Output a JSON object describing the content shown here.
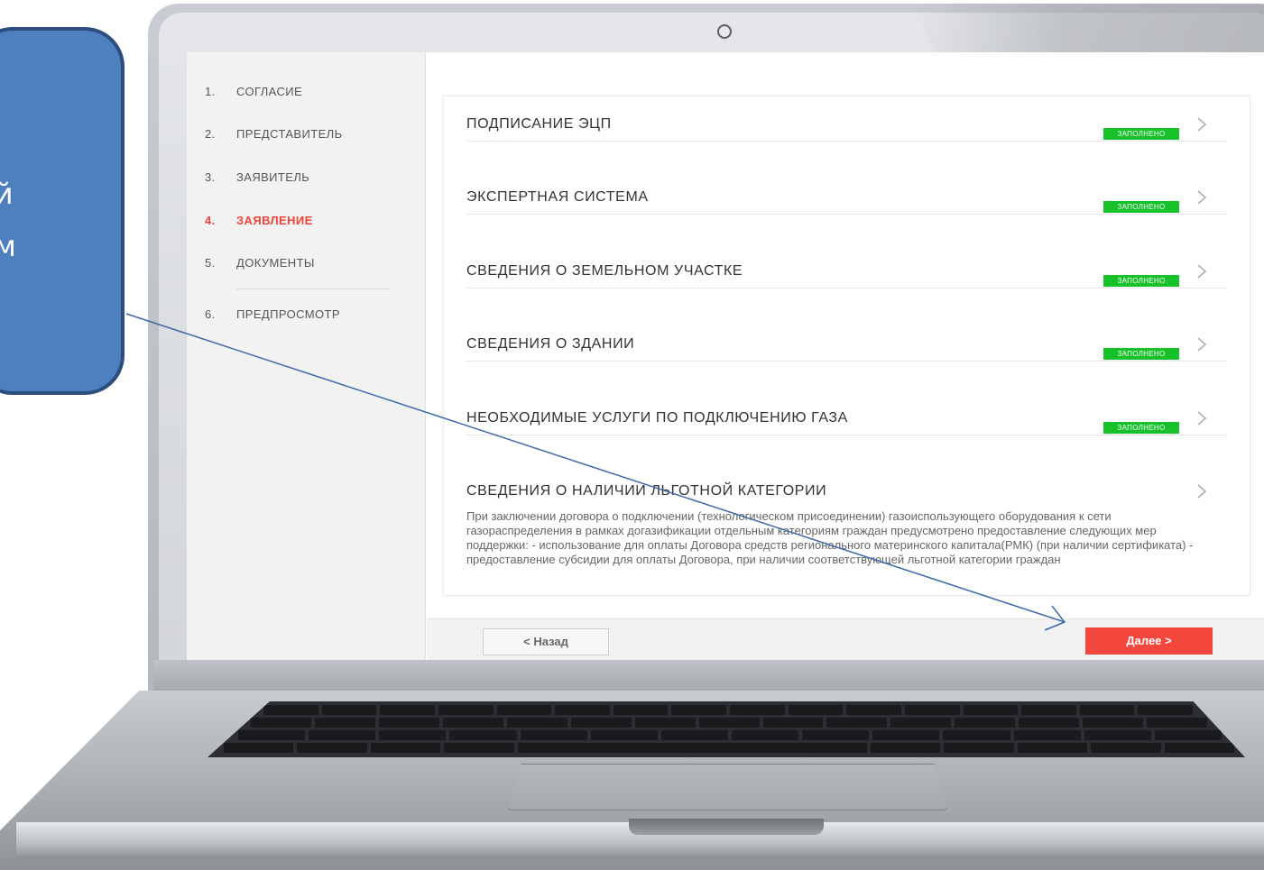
{
  "callout": {
    "text": "ей\nем"
  },
  "sidebar": {
    "steps": [
      {
        "num": "1.",
        "label": "СОГЛАСИЕ"
      },
      {
        "num": "2.",
        "label": "ПРЕДСТАВИТЕЛЬ"
      },
      {
        "num": "3.",
        "label": "ЗАЯВИТЕЛЬ"
      },
      {
        "num": "4.",
        "label": "ЗАЯВЛЕНИЕ"
      },
      {
        "num": "5.",
        "label": "ДОКУМЕНТЫ"
      },
      {
        "num": "6.",
        "label": "ПРЕДПРОСМОТР"
      }
    ],
    "active_step": 4
  },
  "sections": [
    {
      "title": "ПОДПИСАНИЕ ЭЦП",
      "status": "ЗАПОЛНЕНО"
    },
    {
      "title": "ЭКСПЕРТНАЯ СИСТЕМА",
      "status": "ЗАПОЛНЕНО"
    },
    {
      "title": "СВЕДЕНИЯ О ЗЕМЕЛЬНОМ УЧАСТКЕ",
      "status": "ЗАПОЛНЕНО"
    },
    {
      "title": "СВЕДЕНИЯ О ЗДАНИИ",
      "status": "ЗАПОЛНЕНО"
    },
    {
      "title": "НЕОБХОДИМЫЕ УСЛУГИ ПО ПОДКЛЮЧЕНИЮ ГАЗА",
      "status": "ЗАПОЛНЕНО"
    },
    {
      "title": "СВЕДЕНИЯ О НАЛИЧИИ ЛЬГОТНОЙ КАТЕГОРИИ",
      "description": "При заключении договора о подключении (технологическом присоединении) газоиспользующего оборудования к сети газораспределения в рамках догазификации отдельным категориям граждан предусмотрено предоставление следующих мер поддержки: - использование для оплаты Договора средств регионального материнского капитала(РМК) (при наличии сертификата) - предоставление субсидии для оплаты Договора, при наличии соответствующей льготной категории граждан"
    }
  ],
  "footer": {
    "back_label": "< Назад",
    "next_label": "Далее >"
  },
  "colors": {
    "accent": "#f4473e",
    "status_green": "#17c12a",
    "callout_fill": "#4e7fbf",
    "arrow": "#3d6aa8"
  }
}
